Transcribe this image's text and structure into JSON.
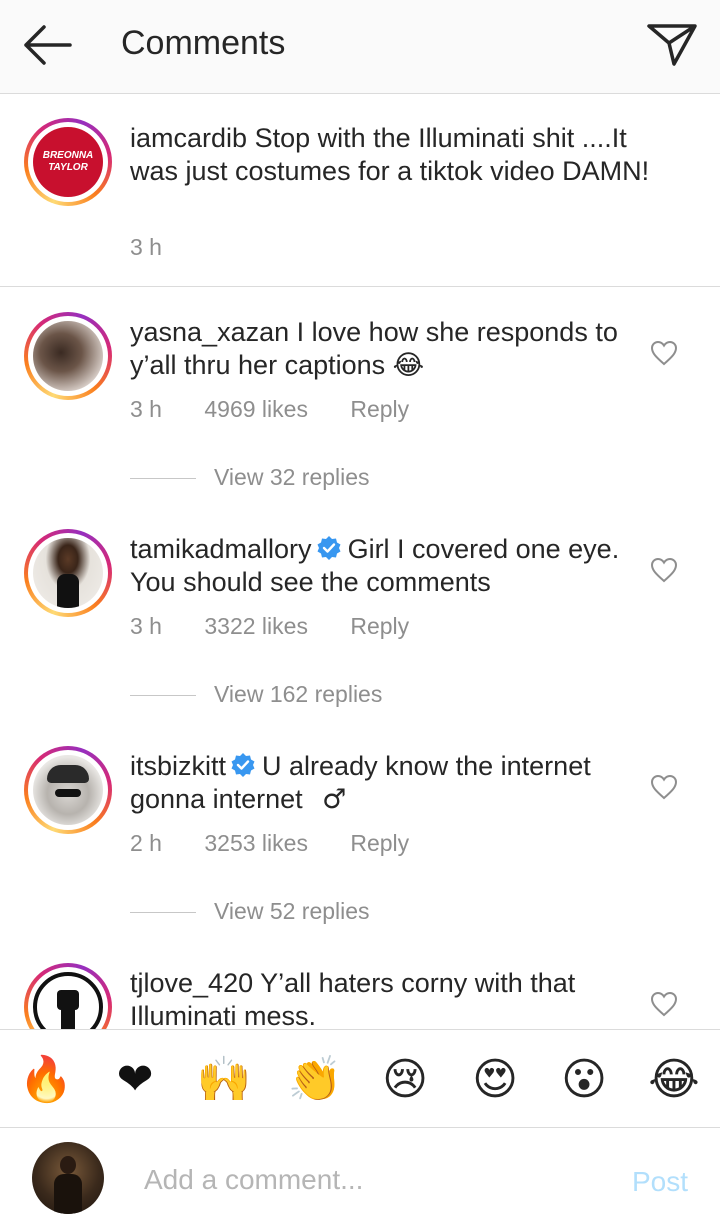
{
  "header": {
    "title": "Comments",
    "back_icon": "arrow-left-icon",
    "dm_icon": "paper-plane-icon"
  },
  "caption": {
    "username": "iamcardib",
    "text": "Stop with the Illuminati shit ....It was just costumes for a tiktok video DAMN!",
    "time": "3 h",
    "avatar_text_1": "BREONNA",
    "avatar_text_2": "TAYLOR"
  },
  "comments": [
    {
      "username": "yasna_xazan",
      "verified": false,
      "text": "I love how she responds to y’all thru her captions",
      "emoji": "😂",
      "time": "3 h",
      "likes": "4969 likes",
      "reply": "Reply",
      "view_replies": "View 32 replies"
    },
    {
      "username": "tamikadmallory",
      "verified": true,
      "text": "Girl I covered one eye. You should see the comments",
      "time": "3 h",
      "likes": "3322 likes",
      "reply": "Reply",
      "view_replies": "View 162 replies"
    },
    {
      "username": "itsbizkitt",
      "verified": true,
      "text": "U already know the internet gonna internet",
      "emoji": "♂",
      "time": "2 h",
      "likes": "3253 likes",
      "reply": "Reply",
      "view_replies": "View 52 replies"
    },
    {
      "username": "tjlove_420",
      "verified": false,
      "text": "Y’all haters corny with that Illuminati mess."
    }
  ],
  "emoji_bar": [
    "🔥",
    "❤",
    "🙌",
    "👏",
    "😢",
    "😍",
    "😮",
    "😂"
  ],
  "input": {
    "placeholder": "Add a comment...",
    "post_label": "Post"
  },
  "colors": {
    "accent_disabled": "#b2dffc",
    "meta_gray": "#8e8e8e",
    "verified_blue": "#3897f0"
  }
}
